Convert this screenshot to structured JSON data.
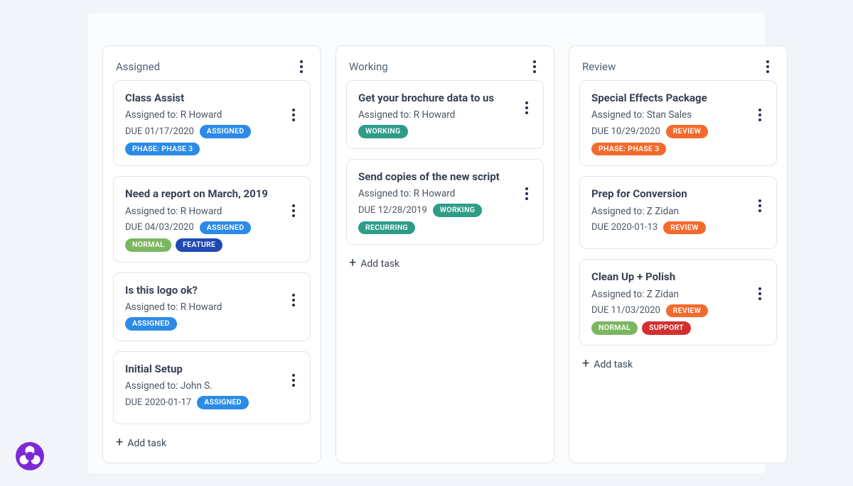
{
  "add_task_label": "Add task",
  "assigned_to_prefix": "Assigned to: ",
  "due_prefix": "DUE ",
  "columns": [
    {
      "title": "Assigned",
      "cards": [
        {
          "title": "Class Assist",
          "assignee": "R Howard",
          "due": "01/17/2020",
          "status_chip": {
            "text": "ASSIGNED",
            "color": "blue"
          },
          "chips": [
            {
              "text": "PHASE: PHASE 3",
              "color": "blue"
            }
          ]
        },
        {
          "title": "Need a report on March, 2019",
          "assignee": "R Howard",
          "due": "04/03/2020",
          "status_chip": {
            "text": "ASSIGNED",
            "color": "blue"
          },
          "chips": [
            {
              "text": "NORMAL",
              "color": "green"
            },
            {
              "text": "FEATURE",
              "color": "bluepill"
            }
          ]
        },
        {
          "title": "Is this logo ok?",
          "assignee": "R Howard",
          "due": null,
          "status_chip": null,
          "chips": [
            {
              "text": "ASSIGNED",
              "color": "blue"
            }
          ]
        },
        {
          "title": "Initial Setup",
          "assignee": "John S.",
          "due": "2020-01-17",
          "status_chip": {
            "text": "ASSIGNED",
            "color": "blue"
          },
          "chips": []
        }
      ]
    },
    {
      "title": "Working",
      "cards": [
        {
          "title": "Get your brochure data to us",
          "assignee": "R Howard",
          "due": null,
          "status_chip": null,
          "chips": [
            {
              "text": "WORKING",
              "color": "teal"
            }
          ]
        },
        {
          "title": "Send copies of the new script",
          "assignee": "R Howard",
          "due": "12/28/2019",
          "status_chip": {
            "text": "WORKING",
            "color": "teal"
          },
          "chips": [
            {
              "text": "RECURRING",
              "color": "teal"
            }
          ]
        }
      ]
    },
    {
      "title": "Review",
      "cards": [
        {
          "title": "Special Effects Package",
          "assignee": "Stan Sales",
          "due": "10/29/2020",
          "status_chip": {
            "text": "REVIEW",
            "color": "orange"
          },
          "chips": [
            {
              "text": "PHASE: PHASE 3",
              "color": "orange"
            }
          ]
        },
        {
          "title": "Prep for Conversion",
          "assignee": "Z Zidan",
          "due": "2020-01-13",
          "status_chip": {
            "text": "REVIEW",
            "color": "orange"
          },
          "chips": []
        },
        {
          "title": "Clean Up + Polish",
          "assignee": "Z Zidan",
          "due": "11/03/2020",
          "status_chip": {
            "text": "REVIEW",
            "color": "orange"
          },
          "chips": [
            {
              "text": "NORMAL",
              "color": "green"
            },
            {
              "text": "SUPPORT",
              "color": "red"
            }
          ]
        }
      ]
    }
  ]
}
